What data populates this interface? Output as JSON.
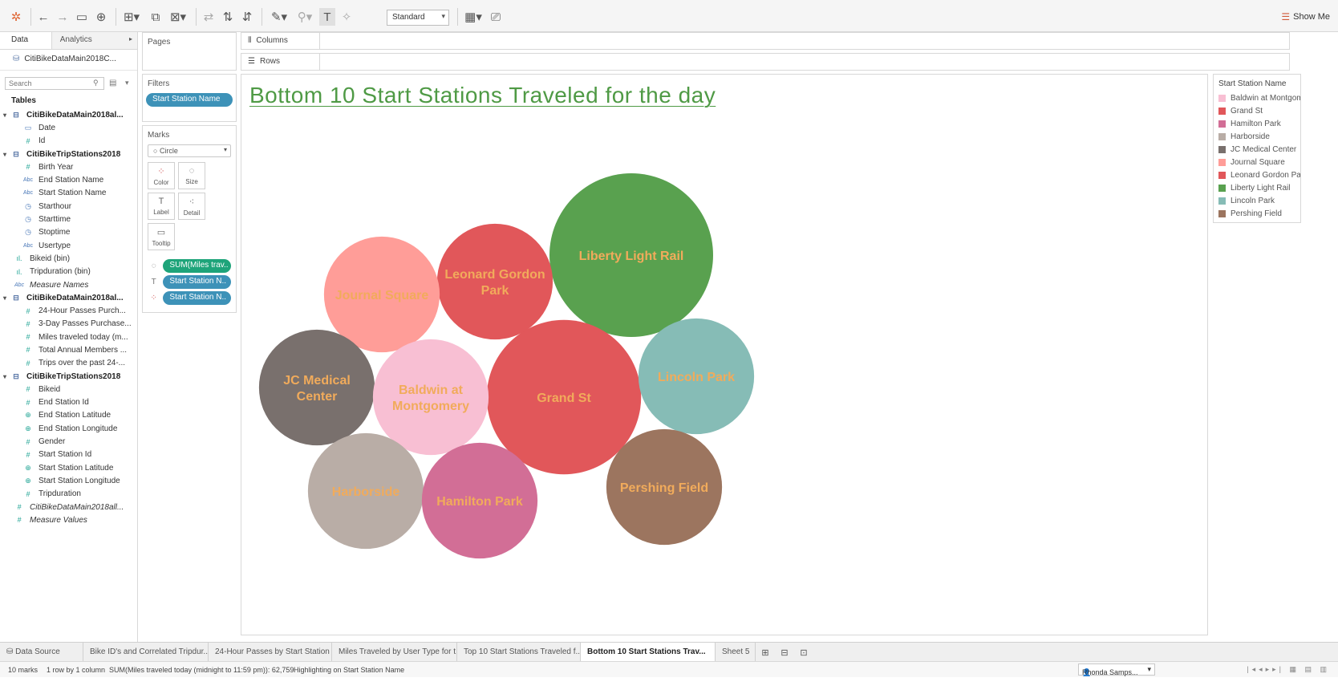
{
  "toolbar": {
    "mark_fit": "Standard",
    "show_me_label": "Show Me"
  },
  "data_pane": {
    "tab_data": "Data",
    "tab_analytics": "Analytics",
    "datasource": "CitiBikeDataMain2018C...",
    "search_placeholder": "Search",
    "tables_heading": "Tables",
    "fields": [
      {
        "kind": "table",
        "label": "CitiBikeDataMain2018al...",
        "icon": "table-icon"
      },
      {
        "kind": "sub",
        "label": "Date",
        "icon": "date-icon"
      },
      {
        "kind": "sub",
        "label": "Id",
        "icon": "measure-icon"
      },
      {
        "kind": "table",
        "label": "CitiBikeTripStations2018",
        "icon": "table-icon"
      },
      {
        "kind": "sub",
        "label": "Birth Year",
        "icon": "measure-icon"
      },
      {
        "kind": "sub",
        "label": "End Station Name",
        "icon": "dimension-icon"
      },
      {
        "kind": "sub",
        "label": "Start Station Name",
        "icon": "dimension-icon"
      },
      {
        "kind": "sub",
        "label": "Starthour",
        "icon": "datetime-icon"
      },
      {
        "kind": "sub",
        "label": "Starttime",
        "icon": "datetime-icon"
      },
      {
        "kind": "sub",
        "label": "Stoptime",
        "icon": "datetime-icon"
      },
      {
        "kind": "sub",
        "label": "Usertype",
        "icon": "dimension-icon"
      },
      {
        "kind": "top",
        "label": "Bikeid (bin)",
        "icon": "bin-icon"
      },
      {
        "kind": "top",
        "label": "Tripduration (bin)",
        "icon": "bin-icon"
      },
      {
        "kind": "top",
        "label": "Measure Names",
        "icon": "dimension-icon",
        "italic": true
      },
      {
        "kind": "table",
        "label": "CitiBikeDataMain2018al...",
        "icon": "table-icon"
      },
      {
        "kind": "sub",
        "label": "24-Hour Passes Purch...",
        "icon": "measure-icon"
      },
      {
        "kind": "sub",
        "label": "3-Day Passes Purchase...",
        "icon": "measure-icon"
      },
      {
        "kind": "sub",
        "label": "Miles traveled today (m...",
        "icon": "measure-icon"
      },
      {
        "kind": "sub",
        "label": "Total Annual Members ...",
        "icon": "measure-icon"
      },
      {
        "kind": "sub",
        "label": "Trips over the past 24-...",
        "icon": "measure-icon"
      },
      {
        "kind": "table",
        "label": "CitiBikeTripStations2018",
        "icon": "table-icon"
      },
      {
        "kind": "sub",
        "label": "Bikeid",
        "icon": "measure-icon"
      },
      {
        "kind": "sub",
        "label": "End Station Id",
        "icon": "measure-icon"
      },
      {
        "kind": "sub",
        "label": "End Station Latitude",
        "icon": "geo-icon"
      },
      {
        "kind": "sub",
        "label": "End Station Longitude",
        "icon": "geo-icon"
      },
      {
        "kind": "sub",
        "label": "Gender",
        "icon": "measure-icon"
      },
      {
        "kind": "sub",
        "label": "Start Station Id",
        "icon": "measure-icon"
      },
      {
        "kind": "sub",
        "label": "Start Station Latitude",
        "icon": "geo-icon"
      },
      {
        "kind": "sub",
        "label": "Start Station Longitude",
        "icon": "geo-icon"
      },
      {
        "kind": "sub",
        "label": "Tripduration",
        "icon": "measure-icon"
      },
      {
        "kind": "top",
        "label": "CitiBikeDataMain2018all...",
        "icon": "measure-icon",
        "italic": true
      },
      {
        "kind": "top",
        "label": "Measure Values",
        "icon": "measure-icon",
        "italic": true
      }
    ]
  },
  "cards": {
    "pages": "Pages",
    "filters": "Filters",
    "filter_pill": "Start Station Name",
    "marks": "Marks",
    "mark_type": "Circle",
    "mark_buttons": [
      "Color",
      "Size",
      "Label",
      "Detail",
      "Tooltip"
    ],
    "mark_pills": [
      "SUM(Miles trav..",
      "Start Station N..",
      "Start Station N.."
    ]
  },
  "shelves": {
    "columns": "Columns",
    "rows": "Rows"
  },
  "view": {
    "title": "Bottom 10 Start Stations Traveled for the day"
  },
  "legend": {
    "title": "Start Station Name",
    "items": [
      {
        "label": "Baldwin at Montgomery",
        "color": "#f8bfd3"
      },
      {
        "label": "Grand St",
        "color": "#e1575a"
      },
      {
        "label": "Hamilton Park",
        "color": "#d26e96"
      },
      {
        "label": "Harborside",
        "color": "#b9ada6"
      },
      {
        "label": "JC Medical Center",
        "color": "#79706d"
      },
      {
        "label": "Journal Square",
        "color": "#ff9d98"
      },
      {
        "label": "Leonard Gordon Park",
        "color": "#e1575a"
      },
      {
        "label": "Liberty Light Rail",
        "color": "#59a14f"
      },
      {
        "label": "Lincoln Park",
        "color": "#86bcb6"
      },
      {
        "label": "Pershing Field",
        "color": "#9c755f"
      }
    ]
  },
  "chart_data": {
    "type": "bubble",
    "measure": "SUM(Miles traveled today (midnight to 11:59 pm))",
    "label_color": "#f1ab5b",
    "bubbles": [
      {
        "name": "Liberty Light Rail",
        "label_lines": [
          "Liberty Light Rail"
        ],
        "color": "#59a14f",
        "rel_size": 1.0
      },
      {
        "name": "Grand St",
        "label_lines": [
          "Grand St"
        ],
        "color": "#e1575a",
        "rel_size": 0.89
      },
      {
        "name": "Leonard Gordon Park",
        "label_lines": [
          "Leonard Gordon",
          "Park"
        ],
        "color": "#e1575a",
        "rel_size": 0.5
      },
      {
        "name": "Journal Square",
        "label_lines": [
          "Journal Square"
        ],
        "color": "#ff9d98",
        "rel_size": 0.5
      },
      {
        "name": "JC Medical Center",
        "label_lines": [
          "JC Medical",
          "Center"
        ],
        "color": "#79706d",
        "rel_size": 0.5
      },
      {
        "name": "Baldwin at Montgomery",
        "label_lines": [
          "Baldwin at",
          "Montgomery"
        ],
        "color": "#f8bfd3",
        "rel_size": 0.5
      },
      {
        "name": "Lincoln Park",
        "label_lines": [
          "Lincoln Park"
        ],
        "color": "#86bcb6",
        "rel_size": 0.5
      },
      {
        "name": "Harborside",
        "label_lines": [
          "Harborside"
        ],
        "color": "#b9ada6",
        "rel_size": 0.5
      },
      {
        "name": "Hamilton Park",
        "label_lines": [
          "Hamilton Park"
        ],
        "color": "#d26e96",
        "rel_size": 0.5
      },
      {
        "name": "Pershing Field",
        "label_lines": [
          "Pershing Field"
        ],
        "color": "#9c755f",
        "rel_size": 0.5
      }
    ]
  },
  "sheet_tabs": [
    {
      "label": "Data Source",
      "active": false
    },
    {
      "label": "Bike ID's and Correlated Tripdur...",
      "active": false
    },
    {
      "label": "24-Hour Passes by Start Station",
      "active": false
    },
    {
      "label": "Miles Traveled by User Type for t...",
      "active": false
    },
    {
      "label": "Top 10 Start Stations Traveled f...",
      "active": false
    },
    {
      "label": "Bottom 10 Start Stations Trav...",
      "active": true
    },
    {
      "label": "Sheet 5",
      "active": false
    }
  ],
  "status": {
    "marks": "10 marks",
    "layout": "1 row by 1 column",
    "sum": "SUM(Miles traveled today (midnight to 11:59 pm)): 62,759",
    "highlight": "Highlighting on Start Station Name",
    "user": "Rhonda Samps..."
  }
}
